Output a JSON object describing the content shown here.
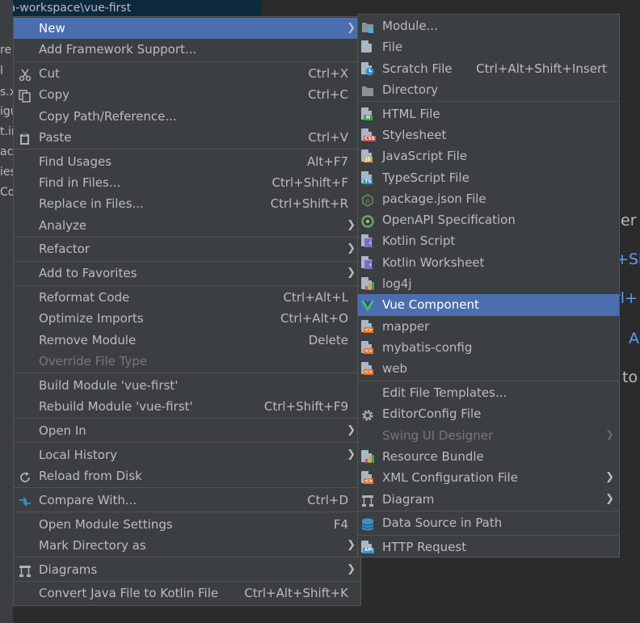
{
  "background": {
    "path_text": "ea-workspace\\vue-first",
    "tree_fragments": [
      "re",
      "l",
      "s.x",
      "igu",
      "t.in",
      "ace",
      "ies",
      "Co"
    ],
    "hints": [
      {
        "name": "hint-1",
        "text": "her",
        "color": "#bbbbbb"
      },
      {
        "name": "hint-2",
        "text": "+Sh",
        "color": "#589df6"
      },
      {
        "name": "hint-3",
        "text": "rl+",
        "color": "#589df6"
      },
      {
        "name": "hint-4",
        "text": "A",
        "color": "#589df6"
      },
      {
        "name": "hint-5",
        "text": "to",
        "color": "#bbbbbb"
      }
    ]
  },
  "main_menu": [
    {
      "label": "New",
      "arrow": true,
      "selected": true
    },
    {
      "label": "Add Framework Support..."
    },
    {
      "sep": true
    },
    {
      "label": "Cut",
      "shortcut": "Ctrl+X",
      "icon": "scissors-icon"
    },
    {
      "label": "Copy",
      "shortcut": "Ctrl+C",
      "icon": "copy-icon"
    },
    {
      "label": "Copy Path/Reference..."
    },
    {
      "label": "Paste",
      "shortcut": "Ctrl+V",
      "icon": "clipboard-icon"
    },
    {
      "sep": true
    },
    {
      "label": "Find Usages",
      "shortcut": "Alt+F7"
    },
    {
      "label": "Find in Files...",
      "shortcut": "Ctrl+Shift+F"
    },
    {
      "label": "Replace in Files...",
      "shortcut": "Ctrl+Shift+R"
    },
    {
      "label": "Analyze",
      "arrow": true
    },
    {
      "sep": true
    },
    {
      "label": "Refactor",
      "arrow": true
    },
    {
      "sep": true
    },
    {
      "label": "Add to Favorites",
      "arrow": true
    },
    {
      "sep": true
    },
    {
      "label": "Reformat Code",
      "shortcut": "Ctrl+Alt+L"
    },
    {
      "label": "Optimize Imports",
      "shortcut": "Ctrl+Alt+O"
    },
    {
      "label": "Remove Module",
      "shortcut": "Delete"
    },
    {
      "label": "Override File Type",
      "disabled": true
    },
    {
      "sep": true
    },
    {
      "label": "Build Module 'vue-first'"
    },
    {
      "label": "Rebuild Module 'vue-first'",
      "shortcut": "Ctrl+Shift+F9"
    },
    {
      "sep": true
    },
    {
      "label": "Open In",
      "arrow": true
    },
    {
      "sep": true
    },
    {
      "label": "Local History",
      "arrow": true
    },
    {
      "label": "Reload from Disk",
      "icon": "reload-icon"
    },
    {
      "sep": true
    },
    {
      "label": "Compare With...",
      "shortcut": "Ctrl+D",
      "icon": "compare-icon"
    },
    {
      "sep": true
    },
    {
      "label": "Open Module Settings",
      "shortcut": "F4"
    },
    {
      "label": "Mark Directory as",
      "arrow": true
    },
    {
      "sep": true
    },
    {
      "label": "Diagrams",
      "arrow": true,
      "icon": "diagram-icon"
    },
    {
      "sep": true
    },
    {
      "label": "Convert Java File to Kotlin File",
      "shortcut": "Ctrl+Alt+Shift+K"
    }
  ],
  "sub_menu": [
    {
      "label": "Module...",
      "icon": "module-icon"
    },
    {
      "label": "File",
      "icon": "file-icon"
    },
    {
      "label": "Scratch File",
      "shortcut": "Ctrl+Alt+Shift+Insert",
      "icon": "scratch-file-icon"
    },
    {
      "label": "Directory",
      "icon": "folder-icon"
    },
    {
      "sep": true
    },
    {
      "label": "HTML File",
      "icon": "html-file-icon"
    },
    {
      "label": "Stylesheet",
      "icon": "css-file-icon"
    },
    {
      "label": "JavaScript File",
      "icon": "js-file-icon"
    },
    {
      "label": "TypeScript File",
      "icon": "ts-file-icon"
    },
    {
      "label": "package.json File",
      "icon": "nodejs-icon"
    },
    {
      "label": "OpenAPI Specification",
      "icon": "openapi-icon"
    },
    {
      "label": "Kotlin Script",
      "icon": "kotlin-script-icon"
    },
    {
      "label": "Kotlin Worksheet",
      "icon": "kotlin-worksheet-icon"
    },
    {
      "label": "log4j",
      "icon": "log4j-icon"
    },
    {
      "label": "Vue Component",
      "icon": "vue-icon",
      "selected": true
    },
    {
      "label": "mapper",
      "icon": "xml-file-icon"
    },
    {
      "label": "mybatis-config",
      "icon": "xml-file-icon"
    },
    {
      "label": "web",
      "icon": "xml-file-icon"
    },
    {
      "sep": true
    },
    {
      "label": "Edit File Templates..."
    },
    {
      "label": "EditorConfig File",
      "icon": "gear-icon"
    },
    {
      "label": "Swing UI Designer",
      "arrow": true,
      "disabled": true
    },
    {
      "label": "Resource Bundle",
      "icon": "resource-bundle-icon"
    },
    {
      "label": "XML Configuration File",
      "arrow": true,
      "icon": "xml-file-icon"
    },
    {
      "label": "Diagram",
      "arrow": true,
      "icon": "diagram-icon"
    },
    {
      "sep": true
    },
    {
      "label": "Data Source in Path",
      "icon": "database-icon"
    },
    {
      "sep": true
    },
    {
      "label": "HTTP Request",
      "icon": "api-file-icon"
    }
  ],
  "icon_colors": {
    "folder": "#87939a",
    "module_badge": "#40b6e0",
    "html": "#499c54",
    "css": "#c75450",
    "js": "#d9a343",
    "ts": "#3592c4",
    "nodejs": "#6a9955",
    "openapi": "#6ba65d",
    "kotlin": "#7f6bce",
    "xml": "#e3742b",
    "vue": "#41b883",
    "database": "#3592c4"
  }
}
